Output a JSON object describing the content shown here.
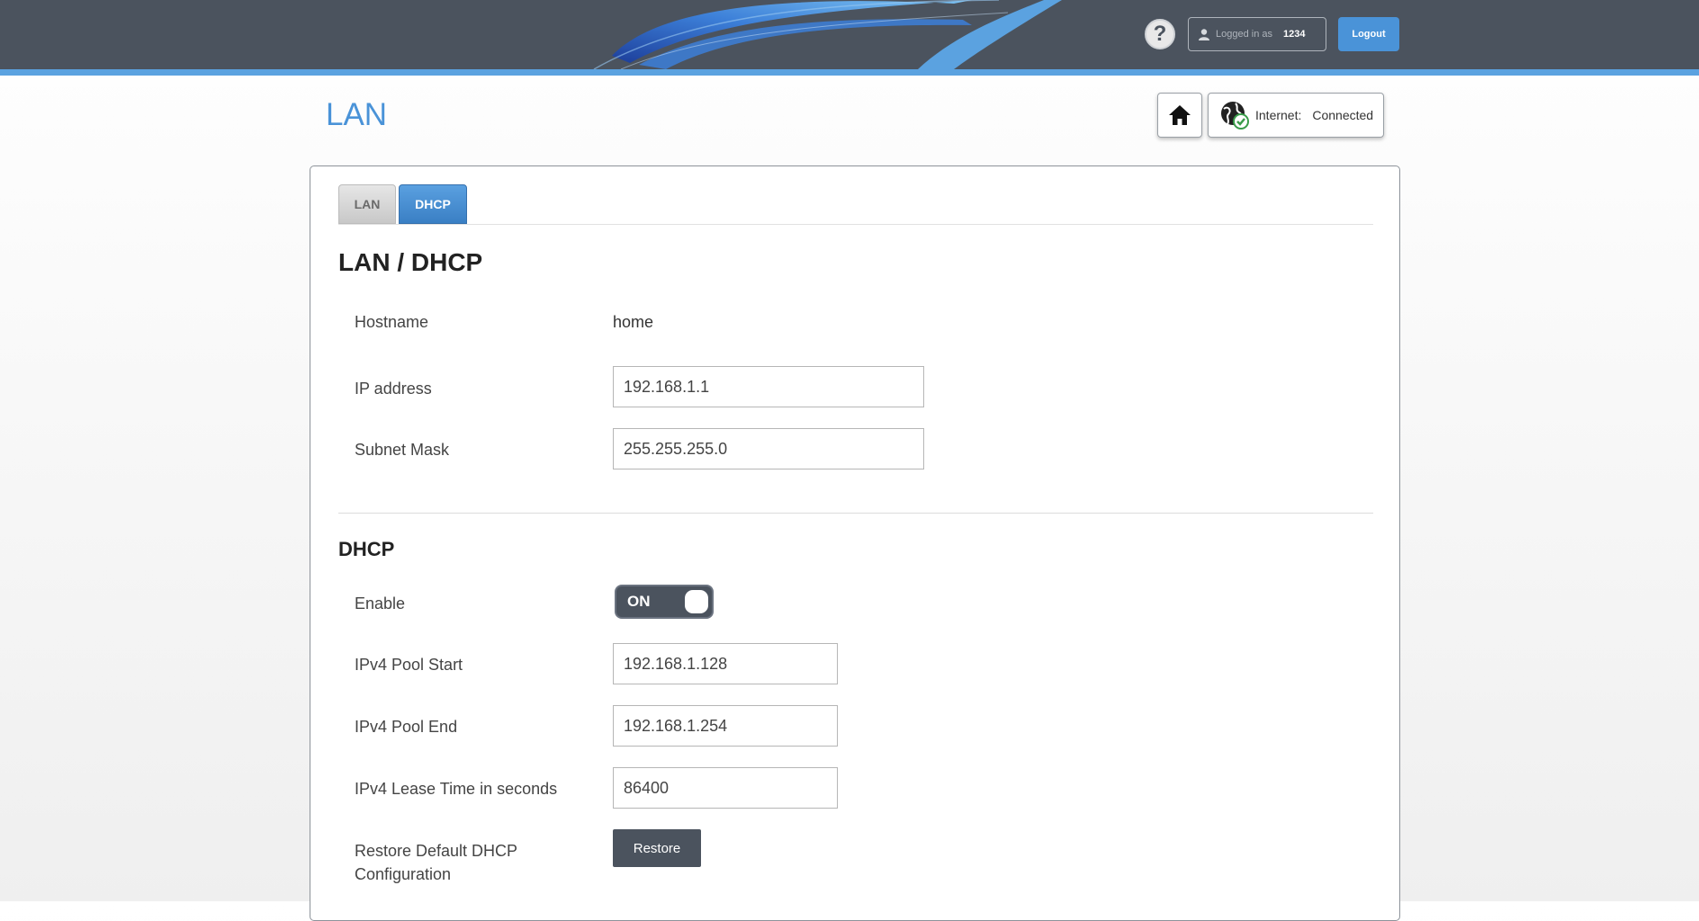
{
  "header": {
    "help_glyph": "?",
    "logged_in_label": "Logged in as",
    "username": "1234",
    "logout_label": "Logout"
  },
  "page": {
    "title": "LAN",
    "internet_label": "Internet:",
    "internet_status": "Connected"
  },
  "tabs": [
    {
      "label": "LAN",
      "active": false
    },
    {
      "label": "DHCP",
      "active": true
    }
  ],
  "lan_section": {
    "title": "LAN / DHCP",
    "hostname_label": "Hostname",
    "hostname_value": "home",
    "ip_label": "IP address",
    "ip_value": "192.168.1.1",
    "subnet_label": "Subnet Mask",
    "subnet_value": "255.255.255.0"
  },
  "dhcp_section": {
    "title": "DHCP",
    "enable_label": "Enable",
    "enable_state": "ON",
    "pool_start_label": "IPv4 Pool Start",
    "pool_start_value": "192.168.1.128",
    "pool_end_label": "IPv4 Pool End",
    "pool_end_value": "192.168.1.254",
    "lease_label": "IPv4 Lease Time in seconds",
    "lease_value": "86400",
    "restore_label": "Restore Default DHCP Configuration",
    "restore_button": "Restore"
  },
  "colors": {
    "header_bg": "#4b535e",
    "accent_blue": "#4a93d8",
    "toggle_bg": "#4b535e"
  },
  "icons": [
    "help-icon",
    "user-icon",
    "home-icon",
    "globe-check-icon"
  ]
}
